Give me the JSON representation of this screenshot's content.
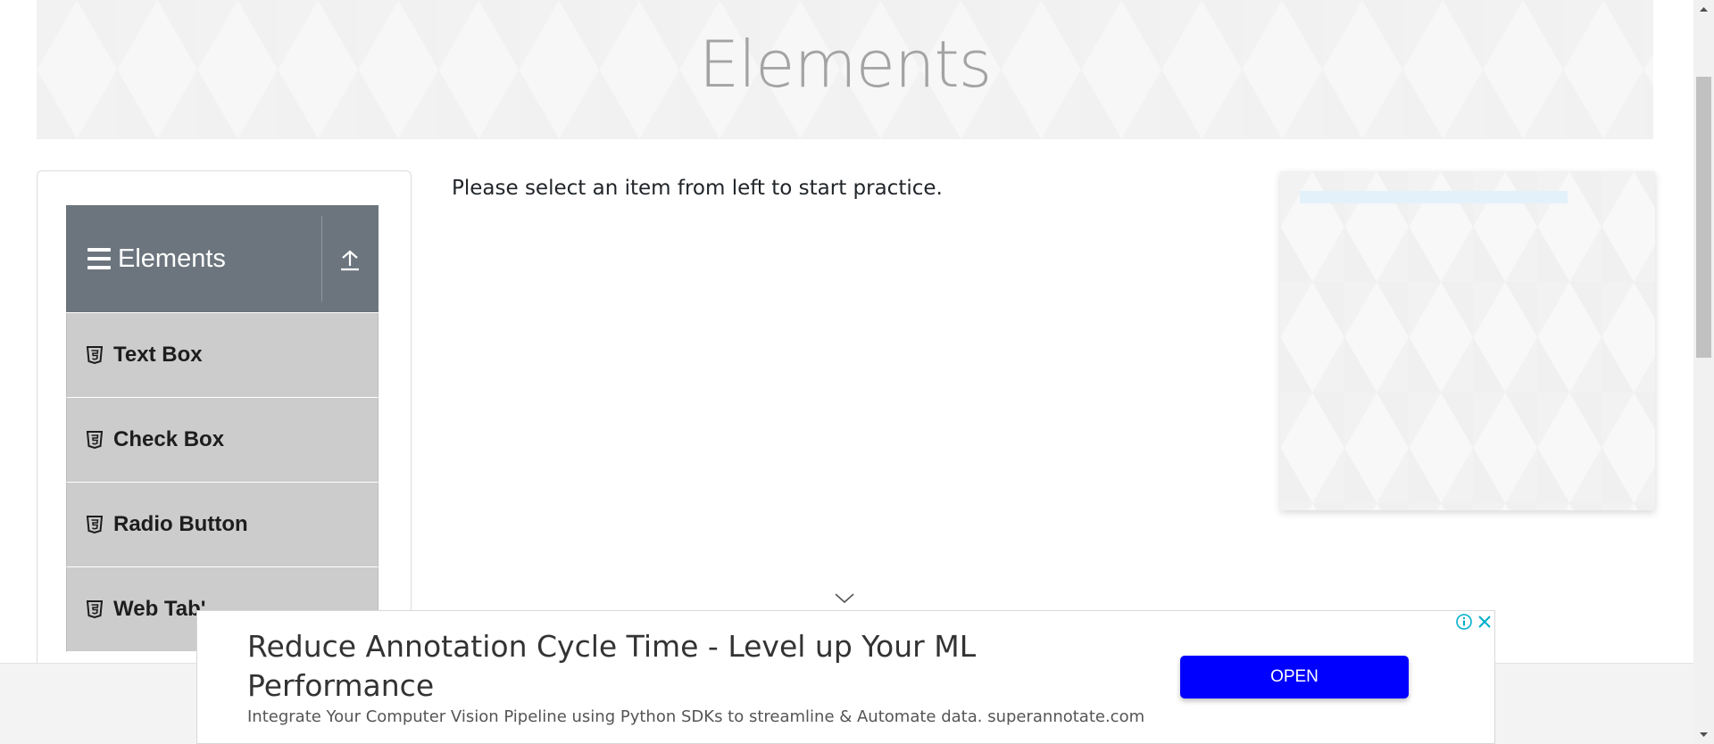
{
  "banner": {
    "title": "Elements"
  },
  "sidebar": {
    "group": {
      "title": "Elements",
      "icon": "menu-icon",
      "collapse_icon": "arrow-up-icon"
    },
    "items": [
      {
        "label": "Text Box",
        "icon": "html5-icon"
      },
      {
        "label": "Check Box",
        "icon": "html5-icon"
      },
      {
        "label": "Radio Button",
        "icon": "html5-icon"
      },
      {
        "label": "Web Tab'",
        "icon": "html5-icon"
      }
    ]
  },
  "main": {
    "intro": "Please select an item from left to start practice."
  },
  "ad": {
    "headline": "Reduce Annotation Cycle Time - Level up Your ML Performance",
    "body": "Integrate Your Computer Vision Pipeline using Python SDKs to streamline & Automate data. superannotate.com",
    "cta": "OPEN",
    "cta_color": "#0000ff"
  },
  "colors": {
    "header_bg": "#6c757d",
    "menu_item_bg": "#cccccc",
    "banner_title": "#a3a3a3"
  }
}
